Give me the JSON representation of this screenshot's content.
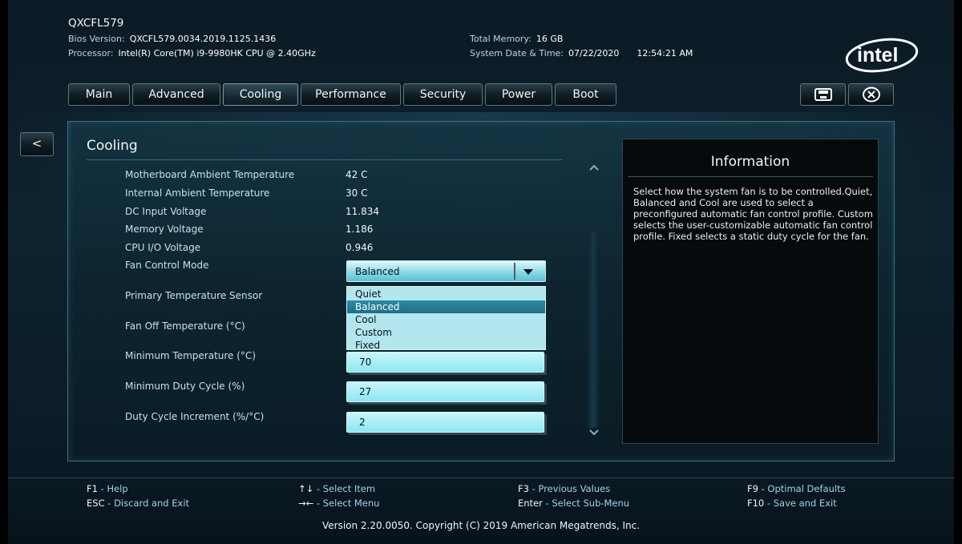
{
  "header": {
    "model": "QXCFL579",
    "bios_label": "Bios Version:",
    "bios_value": "QXCFL579.0034.2019.1125.1436",
    "processor_label": "Processor:",
    "processor_value": "Intel(R) Core(TM) i9-9980HK CPU @ 2.40GHz",
    "memory_label": "Total Memory:",
    "memory_value": "16 GB",
    "datetime_label": "System Date & Time:",
    "date_value": "07/22/2020",
    "time_value": "12:54:21 AM",
    "logo_text": "intel"
  },
  "tabs": [
    {
      "label": "Main"
    },
    {
      "label": "Advanced"
    },
    {
      "label": "Cooling"
    },
    {
      "label": "Performance"
    },
    {
      "label": "Security"
    },
    {
      "label": "Power"
    },
    {
      "label": "Boot"
    }
  ],
  "active_tab": "Cooling",
  "toolbar": {
    "save_icon": "floppy-disk-icon",
    "exit_icon": "close-circle-icon"
  },
  "back_label": "<",
  "main": {
    "title": "Cooling",
    "readings": [
      {
        "label": "Motherboard Ambient Temperature",
        "value": "42 C"
      },
      {
        "label": "Internal Ambient Temperature",
        "value": "30 C"
      },
      {
        "label": "DC Input Voltage",
        "value": "11.834"
      },
      {
        "label": "Memory Voltage",
        "value": "1.186"
      },
      {
        "label": "CPU I/O Voltage",
        "value": "0.946"
      }
    ],
    "fan_mode": {
      "label": "Fan Control Mode",
      "selected": "Balanced",
      "options": [
        "Quiet",
        "Balanced",
        "Cool",
        "Custom",
        "Fixed"
      ]
    },
    "settings": [
      {
        "label": "Primary Temperature Sensor"
      },
      {
        "label": "Fan Off Temperature (°C)"
      },
      {
        "label": "Minimum Temperature (°C)",
        "value": "70"
      },
      {
        "label": "Minimum Duty Cycle (%)",
        "value": "27"
      },
      {
        "label": "Duty Cycle Increment (%/°C)",
        "value": "2"
      }
    ]
  },
  "info": {
    "title": "Information",
    "text": "Select how the system fan is to be controlled.Quiet, Balanced and Cool are used to select a preconfigured automatic fan control profile. Custom selects the user-customizable automatic fan control profile. Fixed selects a static duty cycle for the fan."
  },
  "footer": {
    "help": [
      {
        "key": "F1",
        "desc": "Help"
      },
      {
        "key": "ESC",
        "desc": "Discard and Exit"
      },
      {
        "key": "↑↓",
        "desc": "Select Item"
      },
      {
        "key": "→←",
        "desc": "Select Menu"
      },
      {
        "key": "F3",
        "desc": "Previous Values"
      },
      {
        "key": "Enter",
        "desc": "Select Sub-Menu"
      },
      {
        "key": "F9",
        "desc": "Optimal Defaults"
      },
      {
        "key": "F10",
        "desc": "Save and Exit"
      }
    ],
    "separator": " - ",
    "copyright": "Version 2.20.0050. Copyright (C) 2019 American Megatrends, Inc."
  },
  "colors": {
    "accent": "#8ce7f1",
    "selection": "#1f6f86",
    "label_text": "#c5e1ec",
    "help_desc": "#9fd2e6"
  }
}
